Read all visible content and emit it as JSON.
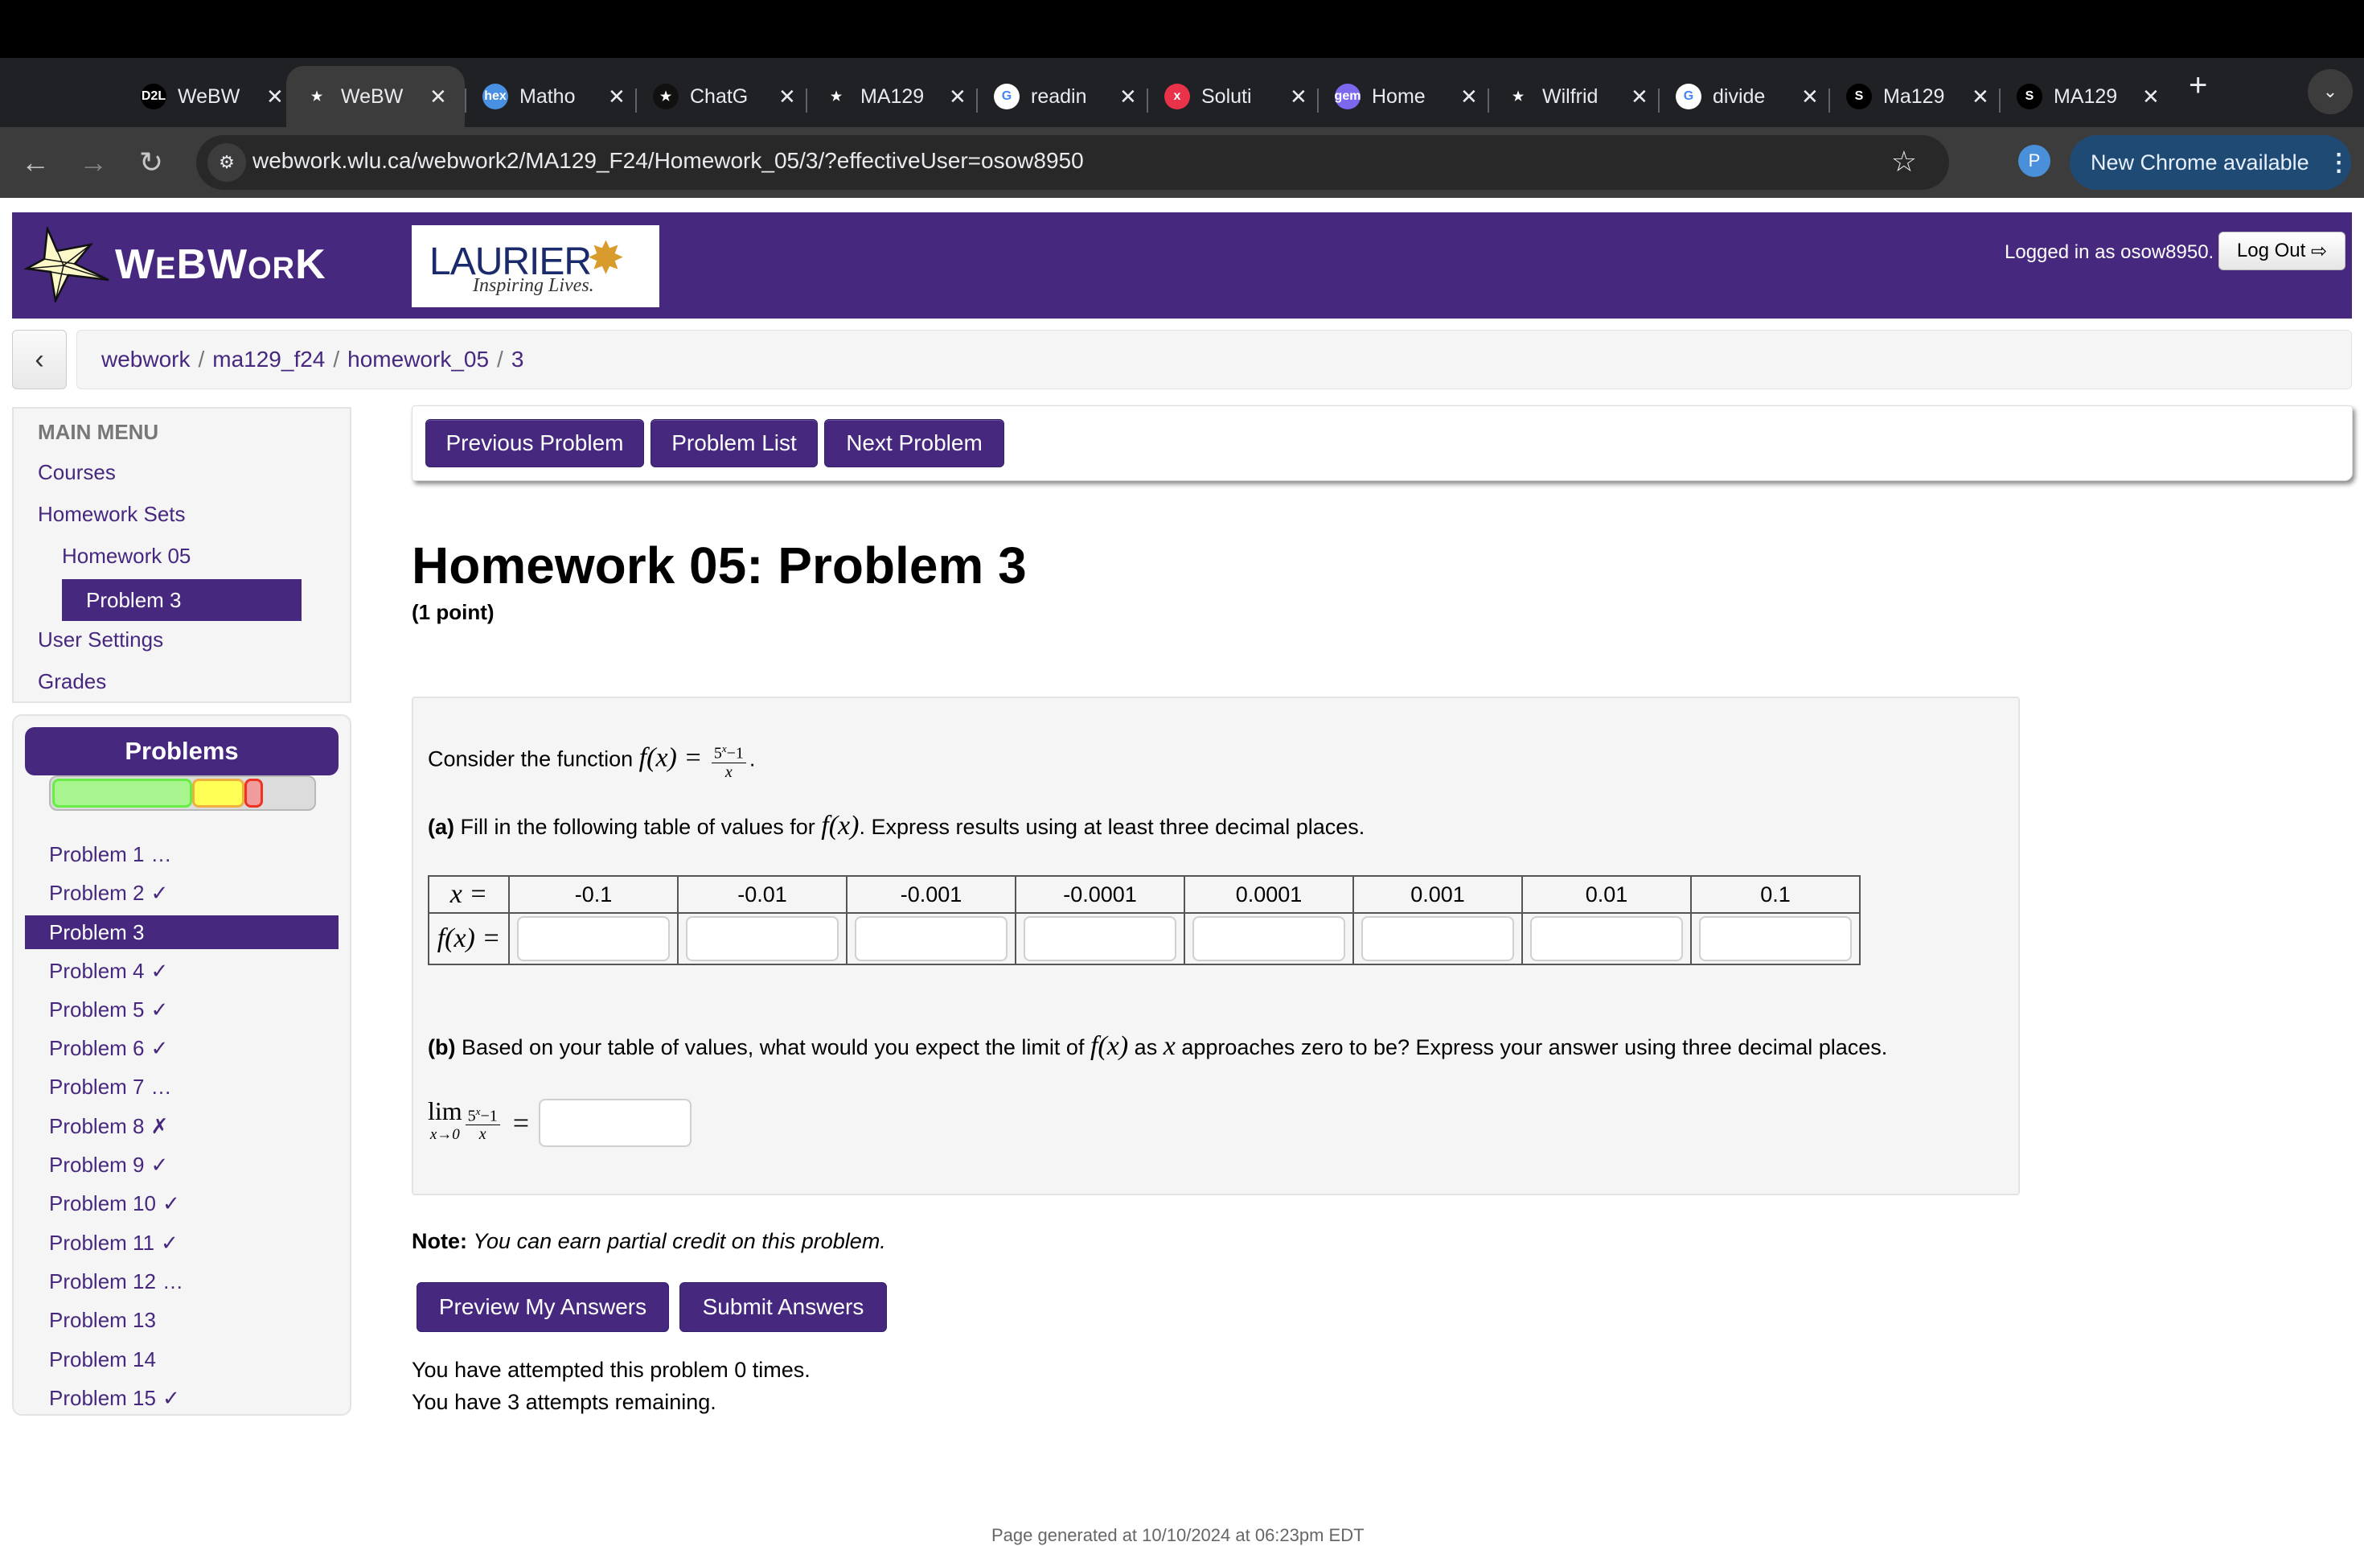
{
  "browser": {
    "tabs": [
      {
        "title": "WeBW",
        "favicon": "D2L",
        "favicon_bg": "#000000",
        "active": false
      },
      {
        "title": "WeBW",
        "favicon": "webwork-star",
        "favicon_bg": "#3c3c3c",
        "active": true
      },
      {
        "title": "Matho",
        "favicon": "hex",
        "favicon_bg": "#4a90e2",
        "active": false
      },
      {
        "title": "ChatG",
        "favicon": "openai",
        "favicon_bg": "#111111",
        "active": false
      },
      {
        "title": "MA129",
        "favicon": "bars",
        "favicon_bg": "#202124",
        "active": false
      },
      {
        "title": "readin",
        "favicon": "G",
        "favicon_bg": "#ffffff",
        "active": false
      },
      {
        "title": "Soluti",
        "favicon": "x",
        "favicon_bg": "#e8334a",
        "active": false
      },
      {
        "title": "Home",
        "favicon": "gem",
        "favicon_bg": "#7b68ee",
        "active": false
      },
      {
        "title": "Wilfrid",
        "favicon": "check",
        "favicon_bg": "#202124",
        "active": false
      },
      {
        "title": "divide",
        "favicon": "G",
        "favicon_bg": "#ffffff",
        "active": false
      },
      {
        "title": "Ma129",
        "favicon": "S",
        "favicon_bg": "#000000",
        "active": false
      },
      {
        "title": "MA129",
        "favicon": "S",
        "favicon_bg": "#000000",
        "active": false
      }
    ],
    "close_glyph": "✕",
    "new_tab_glyph": "+",
    "tab_search_glyph": "⌄",
    "url_host": "webwork.wlu.ca",
    "url_path": "/webwork2/MA129_F24/Homework_05/3/?effectiveUser=osow8950",
    "profile_initial": "P",
    "update_label": "New Chrome available",
    "update_menu_glyph": "⋮"
  },
  "header": {
    "logo_text_parts": [
      "W",
      "E",
      "BW",
      "OR",
      "K"
    ],
    "laurier_word": "LAURIER",
    "laurier_tagline": "Inspiring Lives.",
    "logged_in_text": "Logged in as osow8950.",
    "logout_label": "Log Out",
    "logout_icon": "⇨"
  },
  "breadcrumb": {
    "back_glyph": "‹",
    "items": [
      "webwork",
      "ma129_f24",
      "homework_05",
      "3"
    ],
    "separator": "/"
  },
  "main_menu": {
    "heading": "MAIN MENU",
    "items": [
      {
        "label": "Courses",
        "level": 0,
        "active": false
      },
      {
        "label": "Homework Sets",
        "level": 0,
        "active": false
      },
      {
        "label": "Homework 05",
        "level": 1,
        "active": false
      },
      {
        "label": "Problem 3",
        "level": 2,
        "active": true
      },
      {
        "label": "User Settings",
        "level": 0,
        "active": false
      },
      {
        "label": "Grades",
        "level": 0,
        "active": false
      }
    ]
  },
  "problems_panel": {
    "heading": "Problems",
    "progress": {
      "correct_fraction": 0.53,
      "partial_fraction": 0.2,
      "incorrect_fraction": 0.07,
      "colors": {
        "correct": "#a8f58f",
        "correct_border": "#66ee44",
        "partial": "#ffff55",
        "partial_border": "#f0b040",
        "incorrect": "#f09c9c",
        "incorrect_border": "#ee3322"
      }
    },
    "items": [
      {
        "label": "Problem 1",
        "status": "…",
        "active": false
      },
      {
        "label": "Problem 2",
        "status": "✓",
        "active": false
      },
      {
        "label": "Problem 3",
        "status": "",
        "active": true
      },
      {
        "label": "Problem 4",
        "status": "✓",
        "active": false
      },
      {
        "label": "Problem 5",
        "status": "✓",
        "active": false
      },
      {
        "label": "Problem 6",
        "status": "✓",
        "active": false
      },
      {
        "label": "Problem 7",
        "status": "…",
        "active": false
      },
      {
        "label": "Problem 8",
        "status": "✗",
        "active": false
      },
      {
        "label": "Problem 9",
        "status": "✓",
        "active": false
      },
      {
        "label": "Problem 10",
        "status": "✓",
        "active": false
      },
      {
        "label": "Problem 11",
        "status": "✓",
        "active": false
      },
      {
        "label": "Problem 12",
        "status": "…",
        "active": false
      },
      {
        "label": "Problem 13",
        "status": "",
        "active": false
      },
      {
        "label": "Problem 14",
        "status": "",
        "active": false
      },
      {
        "label": "Problem 15",
        "status": "✓",
        "active": false
      }
    ]
  },
  "nav_buttons": {
    "previous": "Previous Problem",
    "list": "Problem List",
    "next": "Next Problem"
  },
  "problem": {
    "title": "Homework 05: Problem 3",
    "points": "(1 point)",
    "intro_text": "Consider the function",
    "function_lhs": "f(x) =",
    "fraction_numerator_base": "5",
    "fraction_numerator_exp": "x",
    "fraction_numerator_rest": "−1",
    "fraction_denominator": "x",
    "part_a_label": "(a)",
    "part_a_text_1": "Fill in the following table of values for",
    "part_a_math": "f(x)",
    "part_a_text_2": ". Express results using at least three decimal places.",
    "table": {
      "x_label": "x =",
      "fx_label": "f(x) =",
      "x_values": [
        "-0.1",
        "-0.01",
        "-0.001",
        "-0.0001",
        "0.0001",
        "0.001",
        "0.01",
        "0.1"
      ],
      "fx_values": [
        "",
        "",
        "",
        "",
        "",
        "",
        "",
        ""
      ]
    },
    "part_b_label": "(b)",
    "part_b_text_1": "Based on your table of values, what would you expect the limit of",
    "part_b_math_1": "f(x)",
    "part_b_text_2": "as",
    "part_b_math_2": "x",
    "part_b_text_3": "approaches zero to be? Express your answer using three decimal places.",
    "limit_word": "lim",
    "limit_sub": "x→0",
    "limit_equals": "=",
    "limit_answer": ""
  },
  "note": {
    "label": "Note:",
    "text": "You can earn partial credit on this problem."
  },
  "action_buttons": {
    "preview": "Preview My Answers",
    "submit": "Submit Answers"
  },
  "attempts": {
    "attempted": "You have attempted this problem 0 times.",
    "remaining": "You have 3 attempts remaining."
  },
  "footer": {
    "generated": "Page generated at 10/10/2024 at 06:23pm EDT"
  }
}
